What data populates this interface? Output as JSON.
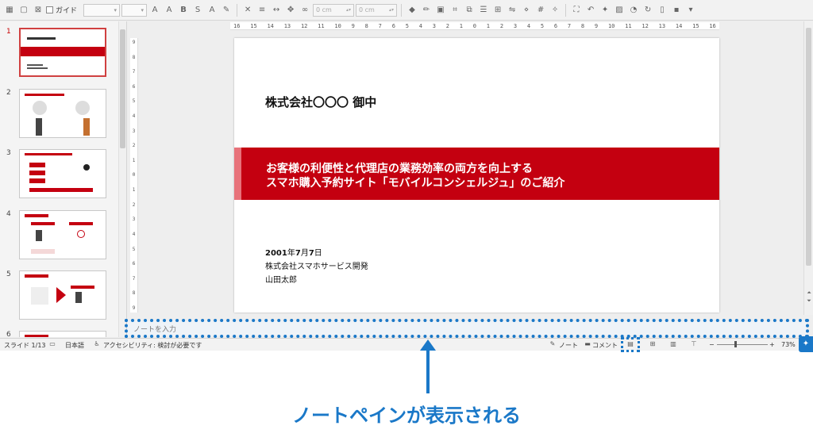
{
  "toolbar": {
    "guide_label": "ガイド",
    "position_x": "0 cm",
    "position_y": "0 cm",
    "format_bold": "B",
    "format_shadow": "S"
  },
  "slides_panel": {
    "slides": [
      {
        "number": "1",
        "active": true
      },
      {
        "number": "2",
        "active": false
      },
      {
        "number": "3",
        "active": false
      },
      {
        "number": "4",
        "active": false
      },
      {
        "number": "5",
        "active": false
      },
      {
        "number": "6",
        "active": false
      }
    ]
  },
  "ruler": {
    "horizontal": [
      "16",
      "15",
      "14",
      "13",
      "12",
      "11",
      "10",
      "9",
      "8",
      "7",
      "6",
      "5",
      "4",
      "3",
      "2",
      "1",
      "0",
      "1",
      "2",
      "3",
      "4",
      "5",
      "6",
      "7",
      "8",
      "9",
      "10",
      "11",
      "12",
      "13",
      "14",
      "15",
      "16"
    ],
    "vertical": [
      "9",
      "8",
      "7",
      "6",
      "5",
      "4",
      "3",
      "2",
      "1",
      "0",
      "1",
      "2",
      "3",
      "4",
      "5",
      "6",
      "7",
      "8",
      "9"
    ]
  },
  "slide": {
    "client": "株式会社〇〇〇 御中",
    "title_line1": "お客様の利便性と代理店の業務効率の両方を向上する",
    "title_line2": "スマホ購入予約サイト「モバイルコンシェルジュ」のご紹介",
    "date_year": "2001",
    "date_year_unit": "年",
    "date_month": "7",
    "date_month_unit": "月",
    "date_day": "7",
    "date_day_unit": "日",
    "company": "株式会社スマホサービス開発",
    "person": "山田太郎"
  },
  "notes": {
    "placeholder": "ノートを入力"
  },
  "statusbar": {
    "slide_count": "スライド 1/13",
    "language": "日本語",
    "accessibility": "アクセシビリティ: 検討が必要です",
    "notes_button": "ノート",
    "comments_button": "コメント",
    "zoom_minus": "−",
    "zoom_plus": "+",
    "zoom": "73%",
    "zoom_level": 0.73
  },
  "annotation": {
    "callout": "ノートペインが表示される"
  },
  "colors": {
    "accent_blue": "#1a78c8",
    "slide_red": "#c40010",
    "slide_red_accent": "#e8727a"
  }
}
